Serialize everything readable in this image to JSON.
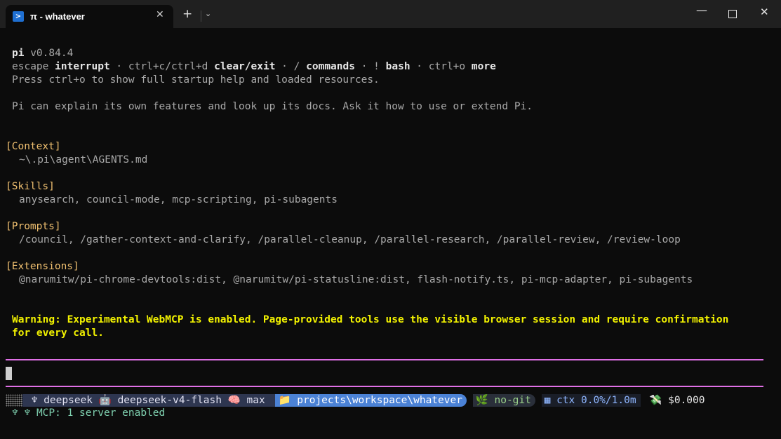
{
  "window": {
    "tab_icon": ">",
    "tab_title": "π - whatever",
    "close_glyph": "✕",
    "new_tab_glyph": "+",
    "dropdown_glyph": "⌄",
    "minimize_glyph": "—",
    "close_window_glyph": "✕"
  },
  "intro": {
    "app": "pi",
    "version": "v0.84.4",
    "keys": [
      {
        "key": "escape",
        "action": "interrupt"
      },
      {
        "key": "ctrl+c/ctrl+d",
        "action": "clear/exit"
      },
      {
        "key": "/",
        "action": "commands"
      },
      {
        "key": "!",
        "action": "bash"
      },
      {
        "key": "ctrl+o",
        "action": "more"
      }
    ],
    "sep": " · ",
    "hint": "Press ctrl+o to show full startup help and loaded resources.",
    "about": "Pi can explain its own features and look up its docs. Ask it how to use or extend Pi."
  },
  "sections": [
    {
      "header": "[Context]",
      "body": "~\\.pi\\agent\\AGENTS.md"
    },
    {
      "header": "[Skills]",
      "body": "anysearch, council-mode, mcp-scripting, pi-subagents"
    },
    {
      "header": "[Prompts]",
      "body": "/council, /gather-context-and-clarify, /parallel-cleanup, /parallel-research, /parallel-review, /review-loop"
    },
    {
      "header": "[Extensions]",
      "body": "@narumitw/pi-chrome-devtools:dist, @narumitw/pi-statusline:dist, flash-notify.ts, pi-mcp-adapter, pi-subagents"
    }
  ],
  "warning": {
    "line1": "Warning: Experimental WebMCP is enabled. Page-provided tools use the visible browser session and require confirmation",
    "line2": "for every call."
  },
  "statusline": {
    "provider_icon": "♆",
    "provider": "deepseek",
    "model_icon": "🤖",
    "model": "deepseek-v4-flash",
    "effort_icon": "🧠",
    "effort": "max",
    "folder_icon": "📁",
    "path": "projects\\workspace\\whatever",
    "git_icon": "🌿",
    "git": "no-git",
    "ctx_icon": "▦",
    "ctx": "ctx 0.0%/1.0m",
    "cost_icon": "💸",
    "cost": "$0.000"
  },
  "mcp": {
    "icons": "♆ ♆",
    "text": "MCP: 1 server enabled"
  }
}
